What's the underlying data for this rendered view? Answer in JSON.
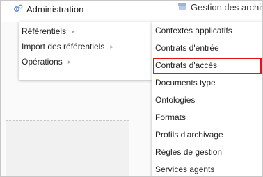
{
  "topbar": {
    "admin_label": "Administration",
    "archive_label": "Gestion des archiv"
  },
  "submenu1": {
    "items": [
      {
        "label": "Référentiels",
        "caret": "▸"
      },
      {
        "label": "Import des référentiels",
        "caret": "▸"
      },
      {
        "label": "Opérations",
        "caret": "▸"
      }
    ]
  },
  "submenu2": {
    "items": [
      {
        "label": "Contextes applicatifs"
      },
      {
        "label": "Contrats d'entrée"
      },
      {
        "label": "Contrats d'accès"
      },
      {
        "label": "Documents type"
      },
      {
        "label": "Ontologies"
      },
      {
        "label": "Formats"
      },
      {
        "label": "Profils d'archivage"
      },
      {
        "label": "Règles de gestion"
      },
      {
        "label": "Services agents"
      }
    ],
    "highlighted_item": "Contrats d'accès",
    "highlight_color": "#e2161a"
  },
  "icons": {
    "admin": "gears-icon",
    "archive": "archive-icon",
    "submenu_caret": "caret-right-icon"
  }
}
